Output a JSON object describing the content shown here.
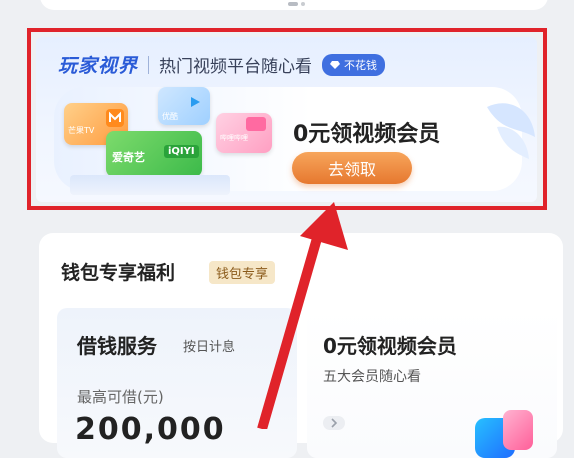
{
  "promo": {
    "brand": "玩家视界",
    "subtitle": "热门视频平台随心看",
    "badge": "不花钱",
    "title": "0元领视频会员",
    "button": "去领取",
    "cards": [
      "芒果TV",
      "爱奇艺",
      "优酷",
      "哔哩哔哩"
    ]
  },
  "wallet": {
    "title": "钱包专享福利",
    "tag": "钱包专享",
    "borrow": {
      "title": "借钱服务",
      "subtitle": "按日计息",
      "limit_label": "最高可借(元)",
      "amount": "200,000"
    },
    "vip": {
      "title": "0元领视频会员",
      "subtitle": "五大会员随心看"
    }
  },
  "colors": {
    "highlight": "#e0232a",
    "brand_blue": "#2a5bd7",
    "button_orange": "#e6782f"
  }
}
